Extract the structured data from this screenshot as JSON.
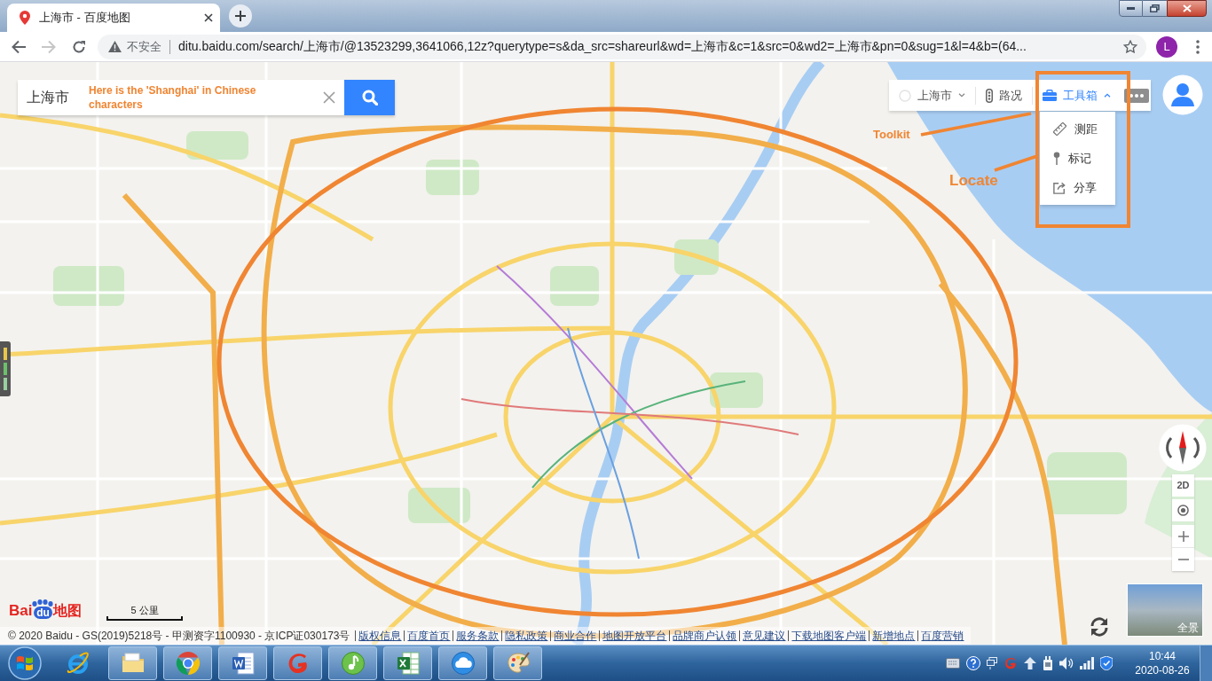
{
  "browser": {
    "tabs": [
      {
        "title": "上海市 - 百度地图",
        "selected": true
      }
    ],
    "nav": [
      {
        "kind": "back",
        "disabled": false
      },
      {
        "kind": "forward",
        "disabled": true
      },
      {
        "kind": "reload",
        "disabled": false
      }
    ],
    "address": {
      "security": "不安全",
      "url": "ditu.baidu.com/search/上海市/@13523299,3641066,12z?querytype=s&da_src=shareurl&wd=上海市&c=1&src=0&wd2=上海市&pn=0&sug=1&l=4&b=(64..."
    },
    "profile_initial": "L"
  },
  "map": {
    "search": {
      "value": "上海市"
    },
    "controls": [
      {
        "kind": "city",
        "label": "上海市",
        "expanded": false
      },
      {
        "kind": "traffic",
        "label": "路况",
        "expanded": false
      },
      {
        "kind": "toolbox",
        "label": "工具箱",
        "expanded": true
      }
    ],
    "toolbox_menu": [
      {
        "kind": "ruler",
        "label": "测距"
      },
      {
        "kind": "pin",
        "label": "标记"
      },
      {
        "kind": "share",
        "label": "分享"
      }
    ],
    "view_mode": "2D",
    "panorama_label": "全景",
    "scale_label": "5 公里",
    "logo": {
      "part_1": "Bai",
      "part_2": "du",
      "part_3": "地图"
    },
    "copyright": "© 2020 Baidu - GS(2019)5218号 - 甲测资字1100930 - 京ICP证030173号",
    "links": [
      "版权信息",
      "百度首页",
      "服务条款",
      "隐私政策",
      "商业合作",
      "地图开放平台",
      "品牌商户认领",
      "意见建议",
      "下载地图客户端",
      "新增地点",
      "百度营销"
    ]
  },
  "annotations": {
    "search_note": "Here is the 'Shanghai' in Chinese characters",
    "toolkit_note": "Toolkit",
    "locate_note": "Locate"
  },
  "taskbar": {
    "apps": [
      {
        "kind": "e_browser",
        "running": false
      },
      {
        "kind": "folder",
        "running": true
      },
      {
        "kind": "circle_browser",
        "running": true
      },
      {
        "kind": "document",
        "running": true
      },
      {
        "kind": "swirl",
        "running": true
      },
      {
        "kind": "music",
        "running": true
      },
      {
        "kind": "spreadsheet",
        "running": true
      },
      {
        "kind": "cloud",
        "running": true
      },
      {
        "kind": "palette",
        "running": true
      }
    ],
    "clock": {
      "time": "10:44",
      "date": "2020-08-26"
    }
  }
}
